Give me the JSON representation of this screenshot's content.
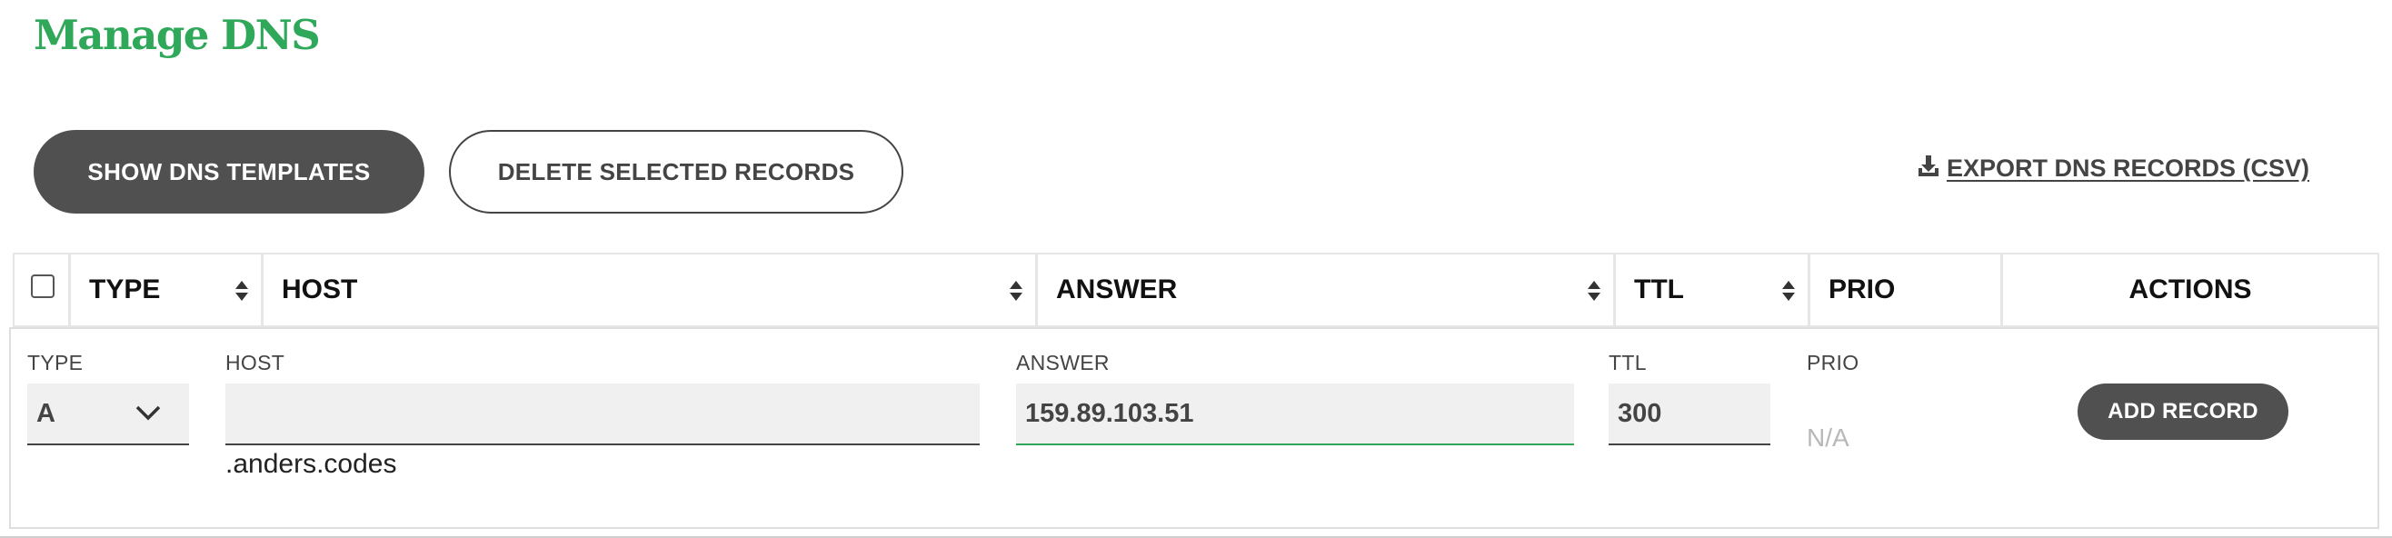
{
  "page": {
    "title": "Manage DNS"
  },
  "toolbar": {
    "show_templates_label": "SHOW DNS TEMPLATES",
    "delete_selected_label": "DELETE SELECTED RECORDS",
    "export_label": "EXPORT DNS RECORDS (CSV)"
  },
  "table": {
    "columns": [
      {
        "label": "TYPE",
        "sortable": true
      },
      {
        "label": "HOST",
        "sortable": true
      },
      {
        "label": "ANSWER",
        "sortable": true
      },
      {
        "label": "TTL",
        "sortable": true
      },
      {
        "label": "PRIO",
        "sortable": false
      },
      {
        "label": "ACTIONS",
        "sortable": false
      }
    ]
  },
  "new_record": {
    "type_label": "TYPE",
    "type_value": "A",
    "host_label": "HOST",
    "host_value": "",
    "host_suffix": ".anders.codes",
    "answer_label": "ANSWER",
    "answer_value": "159.89.103.51",
    "ttl_label": "TTL",
    "ttl_value": "300",
    "prio_label": "PRIO",
    "prio_value": "N/A",
    "add_label": "ADD RECORD"
  },
  "colors": {
    "brand_green": "#2fa85a",
    "button_dark": "#505050"
  },
  "icons": {
    "export": "download-icon",
    "sort": "sort-icon",
    "type_select": "chevron-down-icon"
  }
}
